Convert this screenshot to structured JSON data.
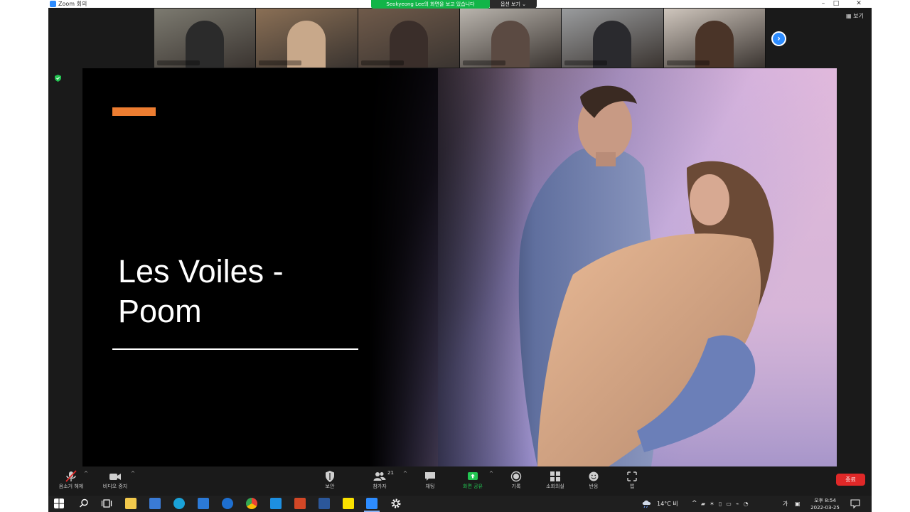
{
  "window": {
    "title": "Zoom 회의",
    "minimize": "–",
    "maximize": "□",
    "close": "✕"
  },
  "share_banner": {
    "text": "Seokyeong Lee의 화면을 보고 있습니다",
    "view_options": "옵션 보기 ⌄"
  },
  "gallery": {
    "view_label": "▦ 보기",
    "next": "›",
    "participants": [
      {
        "bg": "#7c7a70",
        "person": "#2b2b2b"
      },
      {
        "bg": "#8a6f55",
        "person": "#c8a88a"
      },
      {
        "bg": "#6f5a4a",
        "person": "#3a2e2a"
      },
      {
        "bg": "#b9b4ad",
        "person": "#5b4a42"
      },
      {
        "bg": "#9a9c9e",
        "person": "#2a2a2e"
      },
      {
        "bg": "#cfc6bd",
        "person": "#4a3428"
      }
    ]
  },
  "slide": {
    "title_line1": "Les Voiles -",
    "title_line2": "Poom",
    "accent_color": "#ed7d31"
  },
  "controls": {
    "mute": "음소거 해제",
    "video": "비디오 중지",
    "security": "보안",
    "participants": "참가자",
    "participant_count": "21",
    "chat": "채팅",
    "share_screen": "화면 공유",
    "record": "기록",
    "breakout": "소회의실",
    "reactions": "반응",
    "apps": "앱",
    "end": "종료"
  },
  "taskbar": {
    "weather": "14°C 비",
    "ime": "가",
    "time": "오후 8:54",
    "date": "2022-03-25"
  }
}
